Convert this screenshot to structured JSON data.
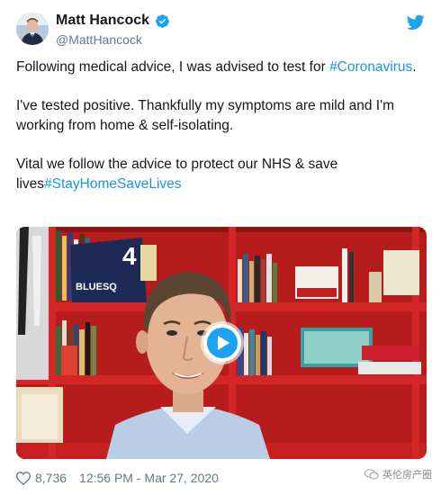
{
  "tweet": {
    "author": {
      "display_name": "Matt Hancock",
      "handle": "@MattHancock",
      "verified": true,
      "avatar_icon": "avatar-photo"
    },
    "text": {
      "p1_text": "Following medical advice, I was advised to test for",
      "p1_hashtag": "#Coronavirus",
      "p1_end": ".",
      "p2_text": "I've tested positive. Thankfully my symptoms are mild and I'm working from home & self-isolating.",
      "p3_text": "Vital we follow the advice to protect our NHS & save lives",
      "p3_hashtag": "#StayHomeSaveLives"
    },
    "media": {
      "type": "video",
      "play_icon": "play-icon"
    },
    "footer": {
      "likes": "8,736",
      "timestamp": "12:56 PM - Mar 27, 2020"
    },
    "brand_icon": "twitter-bird-icon"
  },
  "watermark": {
    "text": "英伦房产圈"
  },
  "colors": {
    "link": "#1b95e0",
    "verified": "#1da1f2",
    "muted": "#657786",
    "shelf_red": "#c21f1f"
  }
}
